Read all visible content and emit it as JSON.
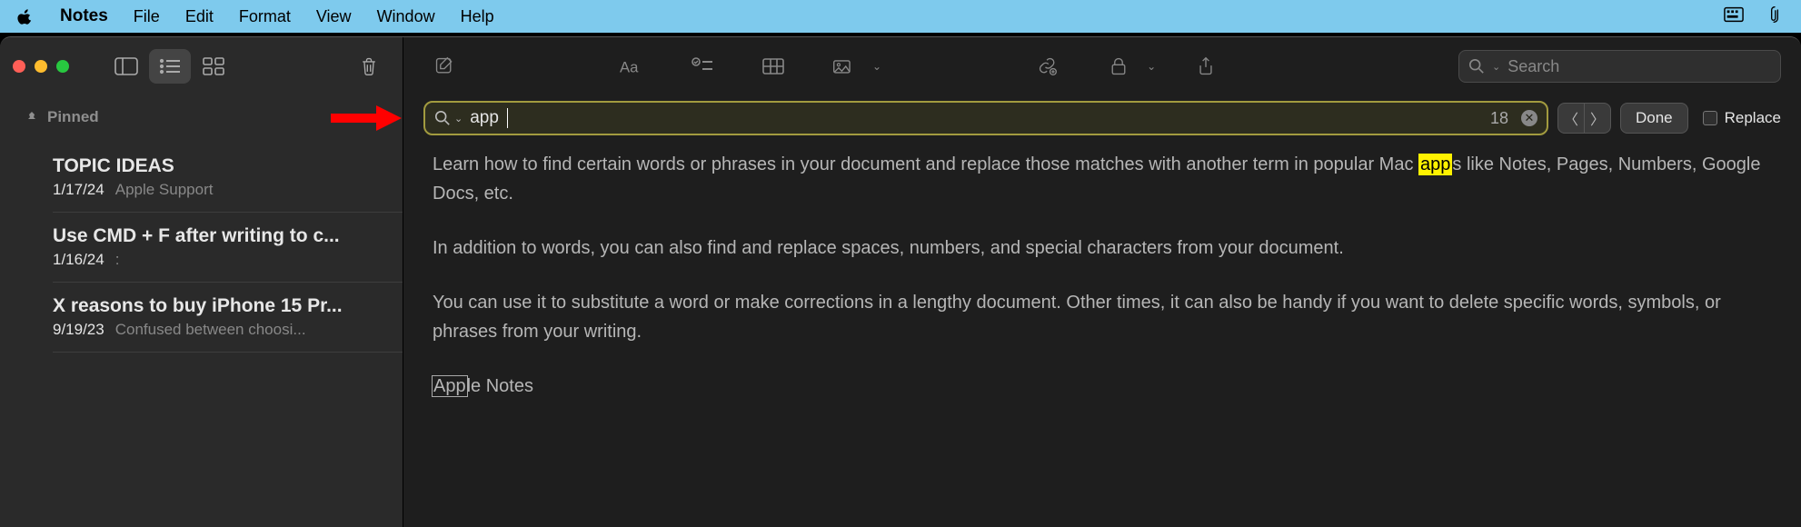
{
  "menubar": {
    "app": "Notes",
    "items": [
      "File",
      "Edit",
      "Format",
      "View",
      "Window",
      "Help"
    ]
  },
  "sidebar": {
    "pinned_label": "Pinned",
    "notes": [
      {
        "title": "TOPIC IDEAS",
        "date": "1/17/24",
        "preview": "Apple Support"
      },
      {
        "title": "Use CMD + F after writing to c...",
        "date": "1/16/24",
        "preview": ":"
      },
      {
        "title": "X reasons to buy iPhone 15 Pr...",
        "date": "9/19/23",
        "preview": "Confused between choosi..."
      }
    ]
  },
  "toolbar": {
    "search_placeholder": "Search"
  },
  "find": {
    "query": "app",
    "count": "18",
    "done_label": "Done",
    "replace_label": "Replace"
  },
  "body": {
    "p1_pre": "Learn how to find certain words or phrases in your document and replace those matches with another term in popular Mac ",
    "p1_hl": "app",
    "p1_post": "s like Notes, Pages, Numbers, Google Docs, etc.",
    "p2": "In addition to words, you can also find and replace spaces, numbers, and special characters from your document.",
    "p3": "You can use it to substitute a word or make corrections in a lengthy document. Other times, it can also be handy if you want to delete specific words, symbols, or phrases from your writing.",
    "p4_box": "App",
    "p4_after": "le Notes"
  }
}
